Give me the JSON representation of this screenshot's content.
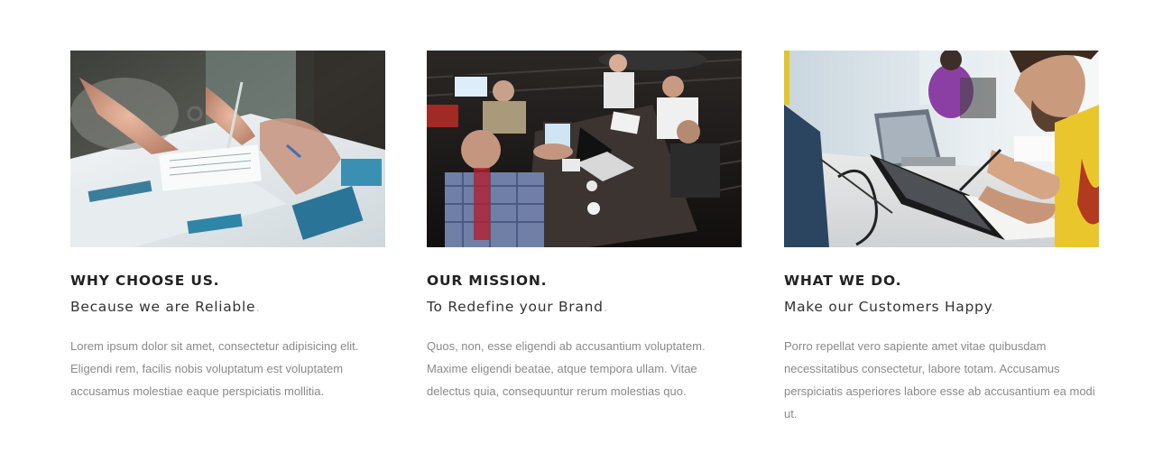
{
  "features": [
    {
      "heading": "WHY CHOOSE US.",
      "tagline": "Because we are Reliable",
      "tagline_end": ".",
      "body": "Lorem ipsum dolor sit amet, consectetur adipisicing elit. Eligendi rem, facilis nobis voluptatum est voluptatem accusamus molestiae eaque perspiciatis mollitia."
    },
    {
      "heading": "OUR MISSION.",
      "tagline": "To Redefine your Brand",
      "tagline_end": ".",
      "body": "Quos, non, esse eligendi ab accusantium voluptatem. Maxime eligendi beatae, atque tempora ullam. Vitae delectus quia, consequuntur rerum molestias quo."
    },
    {
      "heading": "WHAT WE DO.",
      "tagline": "Make our Customers Happy",
      "tagline_end": ".",
      "body": "Porro repellat vero sapiente amet vitae quibusdam necessitatibus consectetur, labore totam. Accusamus perspiciatis asperiores labore esse ab accusantium ea modi ut."
    }
  ],
  "colors": {
    "heading": "#222222",
    "tagline": "#333333",
    "tagline_dot": "#c9c9c9",
    "body": "#8a8a8a"
  }
}
